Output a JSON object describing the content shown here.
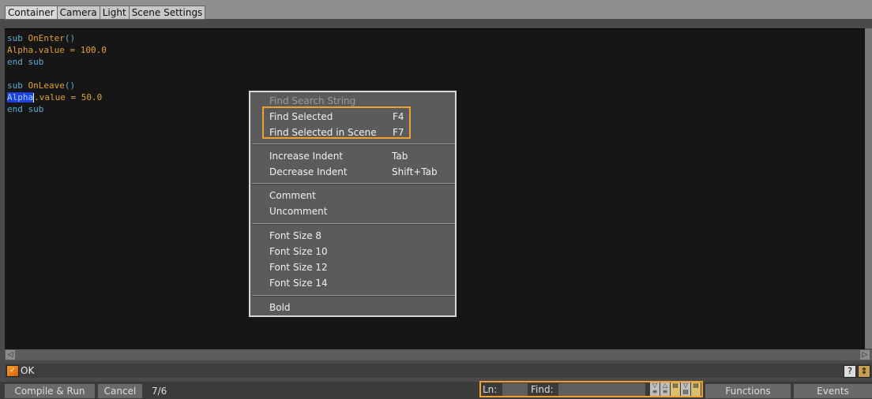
{
  "tabs": [
    "Container",
    "Camera",
    "Light",
    "Scene Settings"
  ],
  "code": {
    "l1_kw": "sub ",
    "l1_fn": "OnEnter",
    "l1_tail": "()",
    "l2_fn": "Alpha",
    "l2_tail": ".value = 100.0",
    "l3": "end sub",
    "l5_kw": "sub ",
    "l5_fn": "OnLeave",
    "l5_tail": "()",
    "l6_sel": "Alpha",
    "l6_tail": ".value = 50.0",
    "l7": "end sub"
  },
  "context_menu": {
    "items": [
      {
        "label": "Find Search String",
        "shortcut": "",
        "enabled": false
      },
      {
        "label": "Find Selected",
        "shortcut": "F4",
        "enabled": true
      },
      {
        "label": "Find Selected in Scene",
        "shortcut": "F7",
        "enabled": true
      },
      {
        "label": "Increase Indent",
        "shortcut": "Tab",
        "enabled": true
      },
      {
        "label": "Decrease Indent",
        "shortcut": "Shift+Tab",
        "enabled": true
      },
      {
        "label": "Comment",
        "shortcut": "",
        "enabled": true
      },
      {
        "label": "Uncomment",
        "shortcut": "",
        "enabled": true
      },
      {
        "label": "Font Size 8",
        "shortcut": "",
        "enabled": true
      },
      {
        "label": "Font Size 10",
        "shortcut": "",
        "enabled": true
      },
      {
        "label": "Font Size 12",
        "shortcut": "",
        "enabled": true
      },
      {
        "label": "Font Size 14",
        "shortcut": "",
        "enabled": true
      },
      {
        "label": "Bold",
        "shortcut": "",
        "enabled": true
      }
    ]
  },
  "status": {
    "ok_label": "OK",
    "help_glyph": "?"
  },
  "toolbar": {
    "compile_label": "Compile & Run",
    "cancel_label": "Cancel",
    "position": "7/6",
    "ln_label": "Ln:",
    "ln_value": "",
    "find_label": "Find:",
    "find_value": "",
    "functions_label": "Functions",
    "events_label": "Events"
  },
  "colors": {
    "accent_highlight": "#f0a030",
    "keyword": "#5fa9cf",
    "identifier": "#e0a030",
    "selection": "#1f3fe0"
  }
}
